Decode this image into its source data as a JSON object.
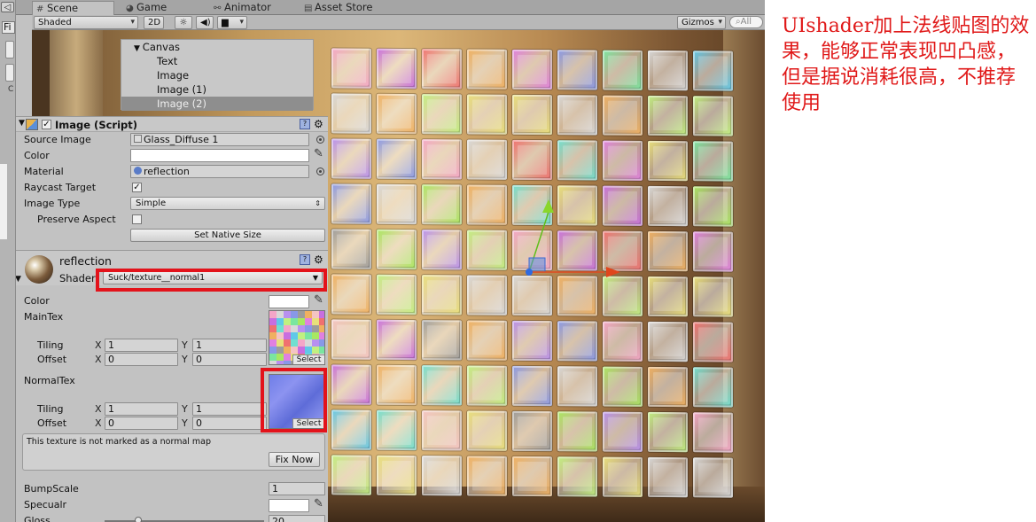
{
  "tabs": [
    {
      "label": "Scene",
      "icon": "hash-icon"
    },
    {
      "label": "Game",
      "icon": "pacman-icon"
    },
    {
      "label": "Animator",
      "icon": "animator-icon"
    },
    {
      "label": "Asset Store",
      "icon": "store-icon"
    }
  ],
  "left_strip": {
    "fi": "Fi"
  },
  "toolbar": {
    "shading_mode": "Shaded",
    "mode_2d": "2D",
    "gizmos": "Gizmos",
    "search": "All"
  },
  "hierarchy": [
    {
      "label": "Canvas",
      "expanded": true,
      "indent": 0
    },
    {
      "label": "Text",
      "indent": 1
    },
    {
      "label": "Image",
      "indent": 1
    },
    {
      "label": "Image (1)",
      "indent": 1
    },
    {
      "label": "Image (2)",
      "indent": 1,
      "selected": true
    }
  ],
  "image_component": {
    "title": "Image (Script)",
    "enabled": true,
    "source_image_label": "Source Image",
    "source_image": "Glass_Diffuse 1",
    "color_label": "Color",
    "color_value": "#ffffff",
    "material_label": "Material",
    "material": "reflection",
    "raycast_label": "Raycast Target",
    "raycast": true,
    "image_type_label": "Image Type",
    "image_type": "Simple",
    "preserve_label": "Preserve Aspect",
    "preserve": false,
    "native_size_button": "Set Native Size"
  },
  "material": {
    "name": "reflection",
    "shader_label": "Shader",
    "shader": "Suck/texture__normal1",
    "color_label": "Color",
    "color_value": "#ffffff",
    "maintex_label": "MainTex",
    "tiling_label": "Tiling",
    "offset_label": "Offset",
    "maintex_tiling": {
      "x": "1",
      "y": "1"
    },
    "maintex_offset": {
      "x": "0",
      "y": "0"
    },
    "normaltex_label": "NormalTex",
    "normaltex_tiling": {
      "x": "1",
      "y": "1"
    },
    "normaltex_offset": {
      "x": "0",
      "y": "0"
    },
    "select_label": "Select",
    "x_label": "X",
    "y_label": "Y",
    "warning": "This texture is not marked as a normal map",
    "fix_button": "Fix Now",
    "bumpscale_label": "BumpScale",
    "bumpscale": "1",
    "specular_label": "Specualr",
    "specular_value": "#ffffff",
    "gloss_label": "Gloss",
    "gloss": "20"
  },
  "annotation": "UIshader加上法线贴图的效果，能够正常表现凹凸感，但是据说消耗很高，不推荐使用",
  "colors": {
    "highlight": "#e3131b",
    "annotation": "#e01919",
    "editor_bg": "#c2c2c2"
  }
}
